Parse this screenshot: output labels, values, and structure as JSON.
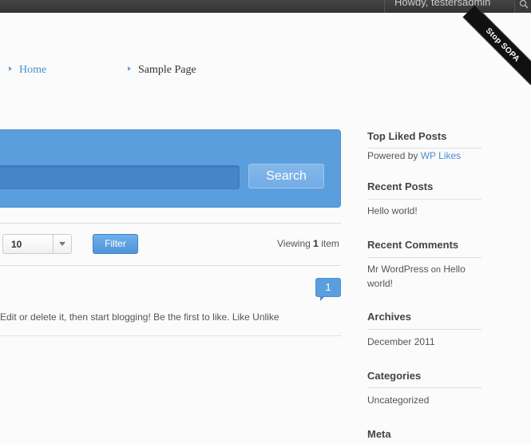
{
  "admin_bar": {
    "howdy": "Howdy, testersadmin"
  },
  "ribbon": {
    "text": "Stop SOPA"
  },
  "nav": {
    "items": [
      {
        "label": "Home"
      },
      {
        "label": "Sample Page"
      }
    ]
  },
  "search": {
    "placeholder": "",
    "button_label": "Search"
  },
  "filter": {
    "per_page_value": "10",
    "button_label": "Filter",
    "viewing_prefix": "Viewing",
    "viewing_count": "1",
    "viewing_suffix": "item"
  },
  "post": {
    "like_count": "1",
    "excerpt": "Edit or delete it, then start blogging! Be the first to like. Like Unlike"
  },
  "sidebar": {
    "top_liked": {
      "title": "Top Liked Posts",
      "powered_prefix": "Powered by",
      "powered_link": "WP Likes"
    },
    "recent_posts": {
      "title": "Recent Posts",
      "items": [
        "Hello world!"
      ]
    },
    "recent_comments": {
      "title": "Recent Comments",
      "author": "Mr WordPress",
      "on": "on",
      "post_line1": "Hello",
      "post_line2": "world!"
    },
    "archives": {
      "title": "Archives",
      "items": [
        "December 2011"
      ]
    },
    "categories": {
      "title": "Categories",
      "items": [
        "Uncategorized"
      ]
    },
    "meta": {
      "title": "Meta"
    }
  },
  "colors": {
    "accent": "#5a9ede",
    "link": "#4a8ed0",
    "admin_bar": "#3a3a3a"
  },
  "icons": {
    "admin_search": "search-icon",
    "nav_marker": "triangle-right-icon",
    "select_arrow": "chevron-down-icon"
  }
}
